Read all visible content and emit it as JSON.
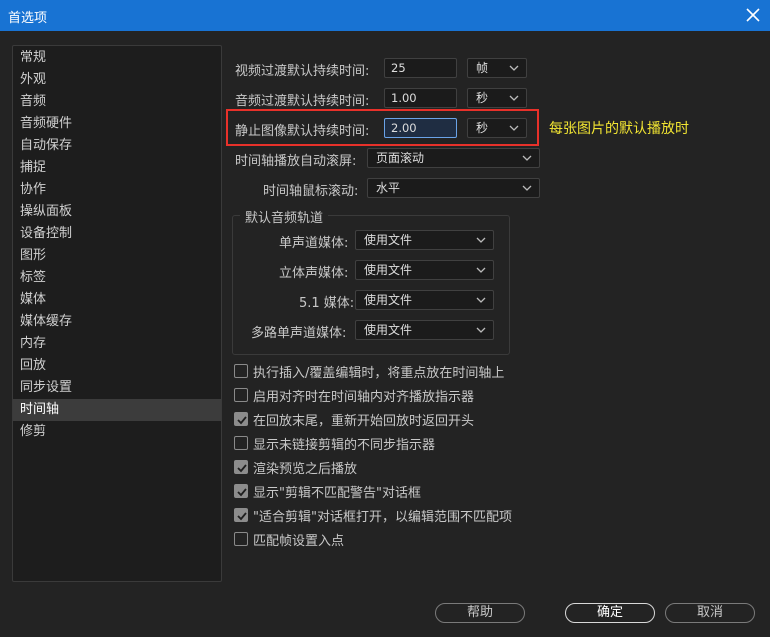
{
  "window": {
    "title": "首选项",
    "close_icon": "close-icon"
  },
  "sidebar": {
    "items": [
      {
        "label": "常规"
      },
      {
        "label": "外观"
      },
      {
        "label": "音频"
      },
      {
        "label": "音频硬件"
      },
      {
        "label": "自动保存"
      },
      {
        "label": "捕捉"
      },
      {
        "label": "协作"
      },
      {
        "label": "操纵面板"
      },
      {
        "label": "设备控制"
      },
      {
        "label": "图形"
      },
      {
        "label": "标签"
      },
      {
        "label": "媒体"
      },
      {
        "label": "媒体缓存"
      },
      {
        "label": "内存"
      },
      {
        "label": "回放"
      },
      {
        "label": "同步设置"
      },
      {
        "label": "时间轴"
      },
      {
        "label": "修剪"
      }
    ],
    "selected": "时间轴"
  },
  "timeline": {
    "video_transition": {
      "label": "视频过渡默认持续时间:",
      "value": "25",
      "unit": "帧"
    },
    "audio_transition": {
      "label": "音频过渡默认持续时间:",
      "value": "1.00",
      "unit": "秒"
    },
    "still_image": {
      "label": "静止图像默认持续时间:",
      "value": "2.00",
      "unit": "秒"
    },
    "auto_scroll": {
      "label": "时间轴播放自动滚屏:",
      "value": "页面滚动"
    },
    "mouse_scroll": {
      "label": "时间轴鼠标滚动:",
      "value": "水平"
    },
    "default_audio_tracks": {
      "title": "默认音频轨道",
      "rows": [
        {
          "label": "单声道媒体:",
          "value": "使用文件"
        },
        {
          "label": "立体声媒体:",
          "value": "使用文件"
        },
        {
          "label": "5.1 媒体:",
          "value": "使用文件"
        },
        {
          "label": "多路单声道媒体:",
          "value": "使用文件"
        }
      ]
    },
    "checkboxes": [
      {
        "label": "执行插入/覆盖编辑时，将重点放在时间轴上",
        "checked": false
      },
      {
        "label": "启用对齐时在时间轴内对齐播放指示器",
        "checked": false
      },
      {
        "label": "在回放末尾，重新开始回放时返回开头",
        "checked": true
      },
      {
        "label": "显示未链接剪辑的不同步指示器",
        "checked": false
      },
      {
        "label": "渲染预览之后播放",
        "checked": true
      },
      {
        "label": "显示\"剪辑不匹配警告\"对话框",
        "checked": true
      },
      {
        "label": "\"适合剪辑\"对话框打开，以编辑范围不匹配项",
        "checked": true
      },
      {
        "label": "匹配帧设置入点",
        "checked": false
      }
    ]
  },
  "annotation": {
    "text": "每张图片的默认播放时",
    "box_color": "#e8312a",
    "text_color": "#f2e532"
  },
  "buttons": {
    "help": "帮助",
    "ok": "确定",
    "cancel": "取消"
  },
  "colors": {
    "titlebar": "#1873d3",
    "background": "#232323"
  }
}
